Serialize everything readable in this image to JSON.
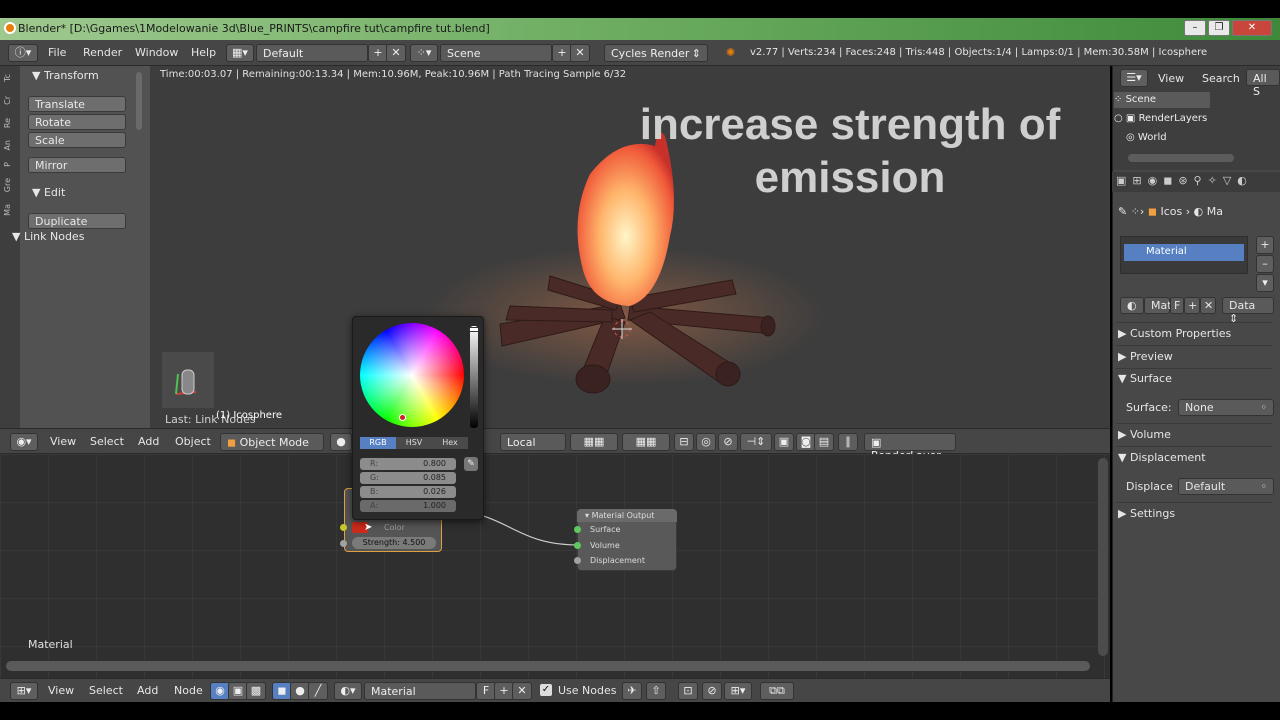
{
  "window": {
    "title": "Blender* [D:\\Ggames\\1Modelowanie 3d\\Blue_PRINTS\\campfire tut\\campfire tut.blend]",
    "minimize": "–",
    "restore": "❐",
    "close": "✕"
  },
  "info_header": {
    "menu": [
      "File",
      "Render",
      "Window",
      "Help"
    ],
    "layout": "Default",
    "scene": "Scene",
    "engine": "Cycles Render",
    "stats": "v2.77 | Verts:234 | Faces:248 | Tris:448 | Objects:1/4 | Lamps:0/1 | Mem:30.58M | Icosphere"
  },
  "tool_panel": {
    "tabs": [
      "Tc",
      "Cr",
      "Re",
      "An",
      "P",
      "Gre",
      "Ma"
    ],
    "transform_title": "Transform",
    "transform_buttons": [
      "Translate",
      "Rotate",
      "Scale"
    ],
    "mirror": "Mirror",
    "edit_title": "Edit",
    "duplicate": "Duplicate",
    "link_nodes_title": "Link Nodes"
  },
  "viewport": {
    "status": "Time:00:03.07 | Remaining:00:13.34 | Mem:10.96M, Peak:10.96M | Path Tracing Sample 6/32",
    "overlay_line1": "increase strength of",
    "overlay_line2": "emission",
    "last_operator": "Last: Link Nodes",
    "object_name": "(1) Icosphere"
  },
  "viewport_header": {
    "menu": [
      "View",
      "Select",
      "Add",
      "Object"
    ],
    "mode": "Object Mode",
    "pivot": "Local",
    "render_layer": "RenderLayer"
  },
  "color_picker": {
    "tabs": [
      "RGB",
      "HSV",
      "Hex"
    ],
    "fields": [
      {
        "label": "R:",
        "value": "0.800"
      },
      {
        "label": "G:",
        "value": "0.085"
      },
      {
        "label": "B:",
        "value": "0.026"
      },
      {
        "label": "A:",
        "value": "1.000"
      }
    ]
  },
  "nodes": {
    "emission": {
      "color_label": "Color",
      "strength": "Strength:   4.500"
    },
    "output": {
      "title": "Material Output",
      "inputs": [
        "Surface",
        "Volume",
        "Displacement"
      ]
    },
    "editor_label": "Material"
  },
  "node_header": {
    "menu": [
      "View",
      "Select",
      "Add",
      "Node"
    ],
    "material": "Material",
    "fake_user": "F",
    "use_nodes": "Use Nodes"
  },
  "outliner": {
    "menu": [
      "View",
      "Search"
    ],
    "filter": "All S",
    "items": [
      "Scene",
      "RenderLayers",
      "World"
    ]
  },
  "properties": {
    "context_object": "Icos",
    "context_material": "Ma",
    "slot": "Material",
    "mat_field": "Mat",
    "mat_f": "F",
    "data_dropdown": "Data",
    "panels": {
      "custom_properties": "Custom Properties",
      "preview": "Preview",
      "surface": "Surface",
      "surface_label": "Surface:",
      "surface_value": "None",
      "volume": "Volume",
      "displacement": "Displacement",
      "displace_label": "Displace",
      "displace_value": "Default",
      "settings": "Settings"
    }
  }
}
